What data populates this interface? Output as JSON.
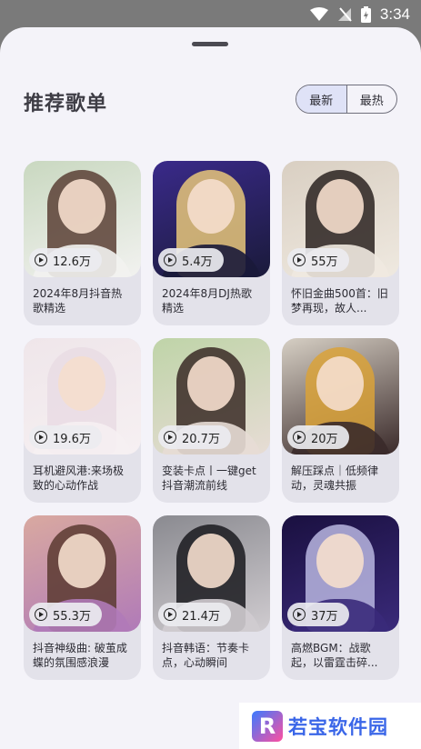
{
  "status": {
    "time": "3:34"
  },
  "sheet": {
    "title": "推荐歌单",
    "sort_tabs": [
      {
        "label": "最新",
        "active": true
      },
      {
        "label": "最热",
        "active": false
      }
    ]
  },
  "playlists": [
    {
      "plays": "12.6万",
      "title": "2024年8月抖音热歌精选",
      "colors": [
        "#c9d8c0",
        "#5a4035",
        "#f2f2f0"
      ]
    },
    {
      "plays": "5.4万",
      "title": "2024年8月DJ热歌精选",
      "colors": [
        "#3a2a8a",
        "#e8c77a",
        "#1a1a3a"
      ]
    },
    {
      "plays": "55万",
      "title": "怀旧金曲500首：旧梦再现，故人...",
      "colors": [
        "#d9cfc2",
        "#2a2220",
        "#efe9e0"
      ]
    },
    {
      "plays": "19.6万",
      "title": "耳机避风港:来场极致的心动作战",
      "colors": [
        "#efe6ea",
        "#e9dce4",
        "#f6f0f2"
      ]
    },
    {
      "plays": "20.7万",
      "title": "变装卡点丨一键get抖音潮流前线",
      "colors": [
        "#bfd4a8",
        "#3a2a26",
        "#e7dcd5"
      ]
    },
    {
      "plays": "20万",
      "title": "解压踩点｜低频律动，灵魂共振",
      "colors": [
        "#d6cfc4",
        "#d9a23a",
        "#3a2a2a"
      ]
    },
    {
      "plays": "55.3万",
      "title": "抖音神级曲: 破茧成蝶的氛围感浪漫",
      "colors": [
        "#d9a9a0",
        "#5a3a30",
        "#b07ab8"
      ]
    },
    {
      "plays": "21.4万",
      "title": "抖音韩语：节奏卡点，心动瞬间",
      "colors": [
        "#8a8a90",
        "#1a1a1e",
        "#d0ccd0"
      ]
    },
    {
      "plays": "37万",
      "title": "高燃BGM：战歌起，以雷霆击碎...",
      "colors": [
        "#1a1040",
        "#b9b6e0",
        "#3a2a7a"
      ]
    }
  ],
  "watermark": {
    "logo": "R",
    "text": "若宝软件园"
  }
}
